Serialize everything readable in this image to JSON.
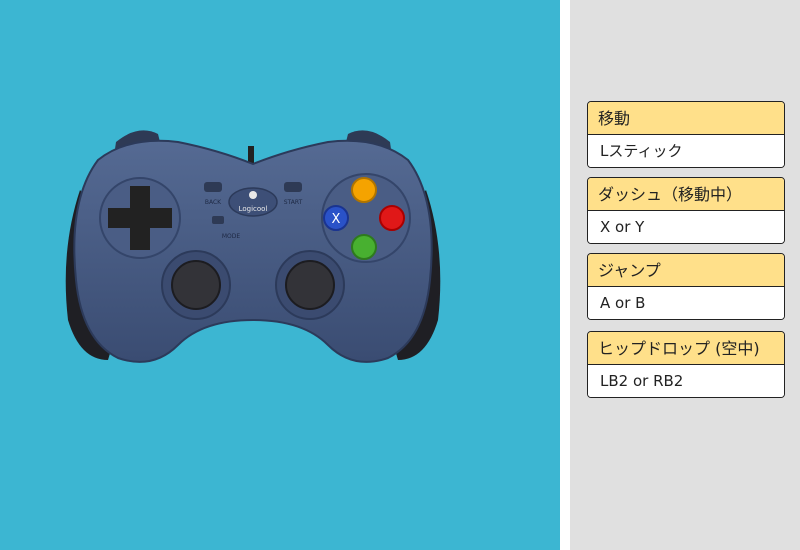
{
  "controller": {
    "logo_text": "Logicool",
    "back_label": "BACK",
    "start_label": "START",
    "mode_label": "MODE",
    "button_x": "X"
  },
  "cards": [
    {
      "action": "移動",
      "input": "Lスティック"
    },
    {
      "action": "ダッシュ（移動中）",
      "input": "X or Y"
    },
    {
      "action": "ジャンプ",
      "input": "A or B"
    },
    {
      "action": "ヒップドロップ (空中)",
      "input": "LB2 or RB2"
    }
  ],
  "colors": {
    "background_left": "#3cb6d2",
    "background_right": "#e0e0e0",
    "card_header": "#ffe08a",
    "button_y": "#f5a300",
    "button_b": "#e01818",
    "button_a": "#48b030",
    "button_x": "#2a52c8"
  }
}
